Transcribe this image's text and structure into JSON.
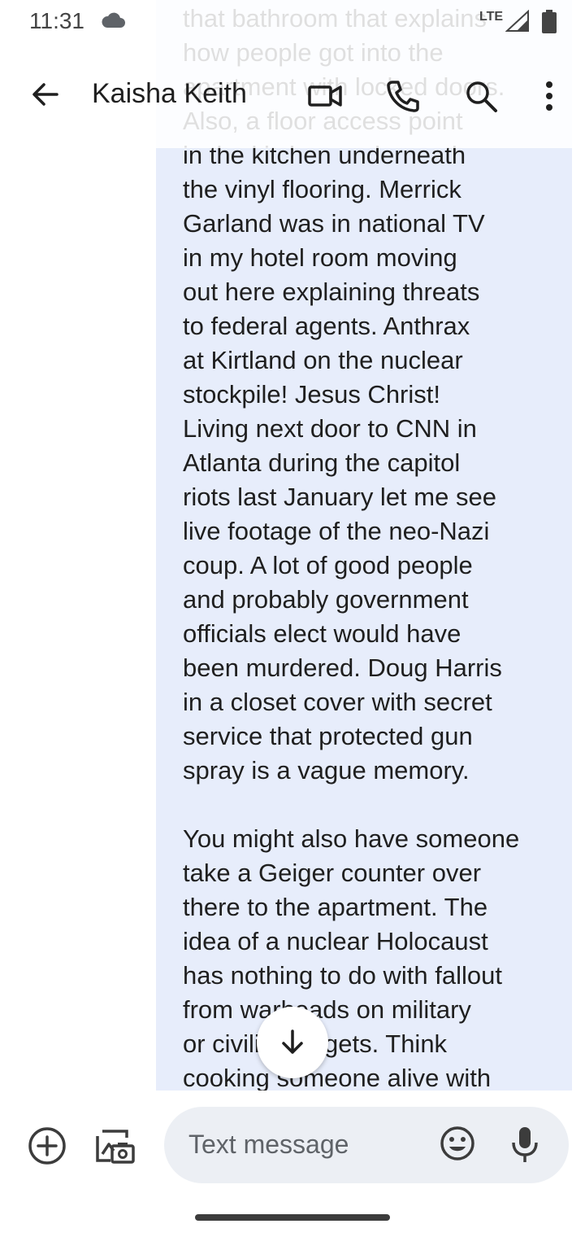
{
  "status_bar": {
    "time": "11:31",
    "network": "LTE",
    "battery_level": "73"
  },
  "header": {
    "contact_name": "Kaisha Keith",
    "icons": [
      "back-arrow-icon",
      "video-call-icon",
      "phone-icon",
      "search-icon",
      "more-vert-icon"
    ]
  },
  "conversation": {
    "message_text": "crawl space entrance in\nthat bathroom that explains\nhow people got into the\napartment with locked doors.\nAlso, a floor access point\nin the kitchen underneath\nthe vinyl flooring. Merrick\nGarland was in national TV\nin my hotel room moving\nout here explaining threats\nto federal agents. Anthrax\nat Kirtland on the nuclear\nstockpile! Jesus Christ!\nLiving next door to CNN in\nAtlanta during the capitol\nriots last January let me see\nlive footage of the neo-Nazi\ncoup. A lot of good people\nand probably government\nofficials elect would have\nbeen murdered. Doug Harris\nin a closet cover with secret\nservice that protected gun\nspray is a vague memory.\n\nYou might also have someone\ntake a Geiger counter over\nthere to the apartment. The\nidea of a nuclear Holocaust\nhas nothing to do with fallout\nfrom warheads on military\nor civilian targets. Think\ncooking someone alive with",
    "bubble_color": "#e7edfb"
  },
  "compose": {
    "placeholder": "Text message",
    "icons": [
      "add-icon",
      "gallery-camera-icon",
      "emoji-icon",
      "mic-icon"
    ]
  }
}
